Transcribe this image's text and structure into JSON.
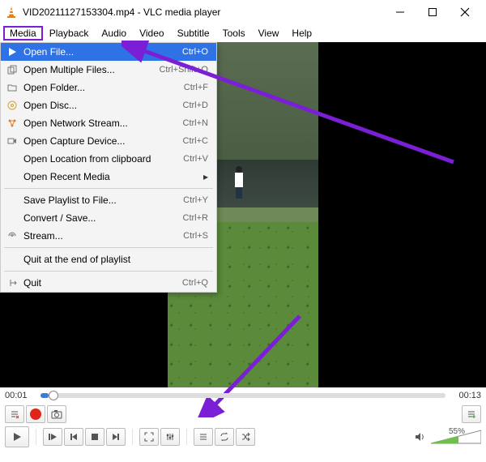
{
  "title": "VID20211127153304.mp4 - VLC media player",
  "menubar": [
    "Media",
    "Playback",
    "Audio",
    "Video",
    "Subtitle",
    "Tools",
    "View",
    "Help"
  ],
  "activeMenuIndex": 0,
  "dropdown": {
    "highlightIndex": 0,
    "sections": [
      [
        {
          "icon": "play-file",
          "label": "Open File...",
          "accel": "Ctrl+O"
        },
        {
          "icon": "multi-file",
          "label": "Open Multiple Files...",
          "accel": "Ctrl+Shift+O"
        },
        {
          "icon": "folder",
          "label": "Open Folder...",
          "accel": "Ctrl+F"
        },
        {
          "icon": "disc",
          "label": "Open Disc...",
          "accel": "Ctrl+D"
        },
        {
          "icon": "network",
          "label": "Open Network Stream...",
          "accel": "Ctrl+N"
        },
        {
          "icon": "capture",
          "label": "Open Capture Device...",
          "accel": "Ctrl+C"
        },
        {
          "icon": "",
          "label": "Open Location from clipboard",
          "accel": "Ctrl+V"
        },
        {
          "icon": "",
          "label": "Open Recent Media",
          "accel": "",
          "submenu": true
        }
      ],
      [
        {
          "icon": "",
          "label": "Save Playlist to File...",
          "accel": "Ctrl+Y"
        },
        {
          "icon": "",
          "label": "Convert / Save...",
          "accel": "Ctrl+R"
        },
        {
          "icon": "stream",
          "label": "Stream...",
          "accel": "Ctrl+S"
        }
      ],
      [
        {
          "icon": "",
          "label": "Quit at the end of playlist",
          "accel": ""
        }
      ],
      [
        {
          "icon": "quit",
          "label": "Quit",
          "accel": "Ctrl+Q"
        }
      ]
    ]
  },
  "time": {
    "current": "00:01",
    "total": "00:13",
    "volume": "55%"
  }
}
